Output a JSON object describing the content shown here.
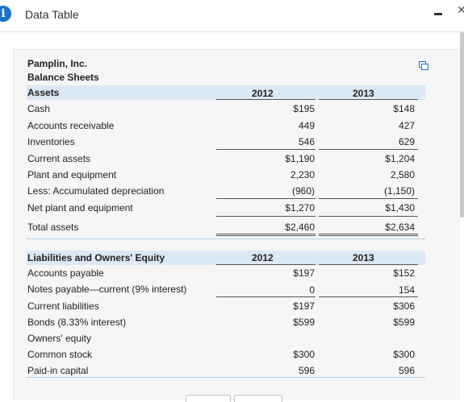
{
  "window": {
    "title": "Data Table",
    "info_icon": "i",
    "close_glyph": "✕"
  },
  "table": {
    "company": "Pamplin, Inc.",
    "statement": "Balance Sheets",
    "assets": {
      "header": "Assets",
      "years": [
        "2012",
        "2013"
      ],
      "rows": [
        {
          "label": "Cash",
          "v2012": "$195",
          "v2013": "$148"
        },
        {
          "label": "Accounts receivable",
          "v2012": "449",
          "v2013": "427"
        },
        {
          "label": "Inventories",
          "v2012": "546",
          "v2013": "629"
        },
        {
          "label": "Current assets",
          "v2012": "$1,190",
          "v2013": "$1,204"
        },
        {
          "label": "Plant and equipment",
          "v2012": "2,230",
          "v2013": "2,580"
        },
        {
          "label": "Less: Accumulated depreciation",
          "v2012": "(960)",
          "v2013": "(1,150)"
        },
        {
          "label": "Net plant and equipment",
          "v2012": "$1,270",
          "v2013": "$1,430"
        },
        {
          "label": "Total assets",
          "v2012": "$2,460",
          "v2013": "$2,634"
        }
      ]
    },
    "liabilities": {
      "header": "Liabilities and Owners' Equity",
      "years": [
        "2012",
        "2013"
      ],
      "rows": [
        {
          "label": "Accounts payable",
          "v2012": "$197",
          "v2013": "$152"
        },
        {
          "label": "Notes payable—current (9% interest)",
          "v2012": "0",
          "v2013": "154"
        },
        {
          "label": "Current liabilities",
          "v2012": "$197",
          "v2013": "$306"
        },
        {
          "label": "Bonds (8.33% interest)",
          "v2012": "$599",
          "v2013": "$599"
        },
        {
          "label": "Owners' equity",
          "v2012": "",
          "v2013": ""
        },
        {
          "label": "Common stock",
          "v2012": "$300",
          "v2013": "$300"
        },
        {
          "label": "Paid-in capital",
          "v2012": "596",
          "v2013": "596"
        }
      ]
    }
  }
}
